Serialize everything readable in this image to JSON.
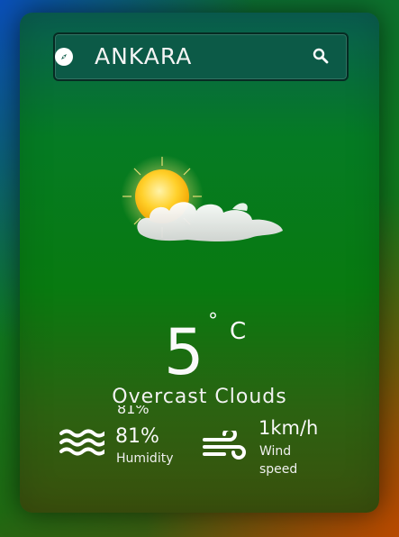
{
  "search": {
    "city": "ANKARA"
  },
  "weather": {
    "temperature": "5",
    "degree_symbol": "°",
    "unit": "C",
    "description": "Overcast Clouds",
    "condition_icon": "sun-behind-cloud-icon"
  },
  "stats": {
    "humidity_ghost": "81%",
    "humidity_value": "81%",
    "humidity_label": "Humidity",
    "wind_value": "1km/h",
    "wind_label": "Wind speed"
  },
  "icons": {
    "location": "compass-icon",
    "search": "search-icon",
    "humidity": "waves-icon",
    "wind": "wind-icon"
  },
  "colors": {
    "text": "#f4f4f4",
    "sun": "#ffc21a"
  }
}
